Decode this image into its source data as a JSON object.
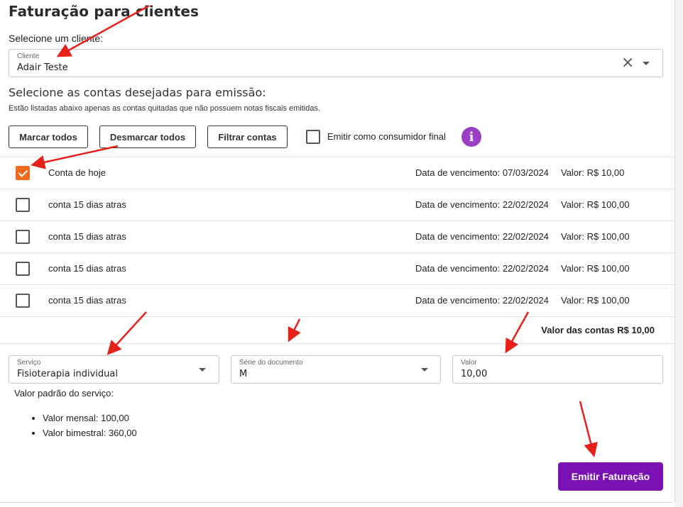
{
  "page": {
    "title": "Faturação para clientes",
    "select_client_label": "Selecione um cliente:"
  },
  "client_field": {
    "label": "Cliente",
    "value": "Adair Teste"
  },
  "accounts_section": {
    "heading": "Selecione as contas desejadas para emissão:",
    "note": "Estão listadas abaixo apenas as contas quitadas que não possuem notas fiscais emitidas.",
    "buttons": {
      "select_all": "Marcar todos",
      "deselect_all": "Desmarcar todos",
      "filter": "Filtrar contas"
    },
    "final_consumer_label": "Emitir como consumidor final",
    "info_icon": "info-icon"
  },
  "accounts": [
    {
      "name": "Conta de hoje",
      "due": "Data de vencimento: 07/03/2024",
      "value": "Valor: R$ 10,00",
      "checked": true
    },
    {
      "name": "conta 15 dias atras",
      "due": "Data de vencimento: 22/02/2024",
      "value": "Valor: R$ 100,00",
      "checked": false
    },
    {
      "name": "conta 15 dias atras",
      "due": "Data de vencimento: 22/02/2024",
      "value": "Valor: R$ 100,00",
      "checked": false
    },
    {
      "name": "conta 15 dias atras",
      "due": "Data de vencimento: 22/02/2024",
      "value": "Valor: R$ 100,00",
      "checked": false
    },
    {
      "name": "conta 15 dias atras",
      "due": "Data de vencimento: 22/02/2024",
      "value": "Valor: R$ 100,00",
      "checked": false
    }
  ],
  "total_label": "Valor das contas R$ 10,00",
  "service_field": {
    "label": "Serviço",
    "value": "Fisioterapia individual"
  },
  "series_field": {
    "label": "Série do documento",
    "value": "M"
  },
  "value_field": {
    "label": "Valor",
    "value": "10,00"
  },
  "default_values": {
    "heading": "Valor padrão do serviço:",
    "items": [
      "Valor mensal: 100,00",
      "Valor bimestral: 360,00"
    ]
  },
  "submit_label": "Emitir Faturação",
  "colors": {
    "accent_orange": "#f06a1e",
    "primary_purple": "#7b11b5",
    "info_purple": "#9b3fc7",
    "arrow_red": "#e8201a"
  }
}
